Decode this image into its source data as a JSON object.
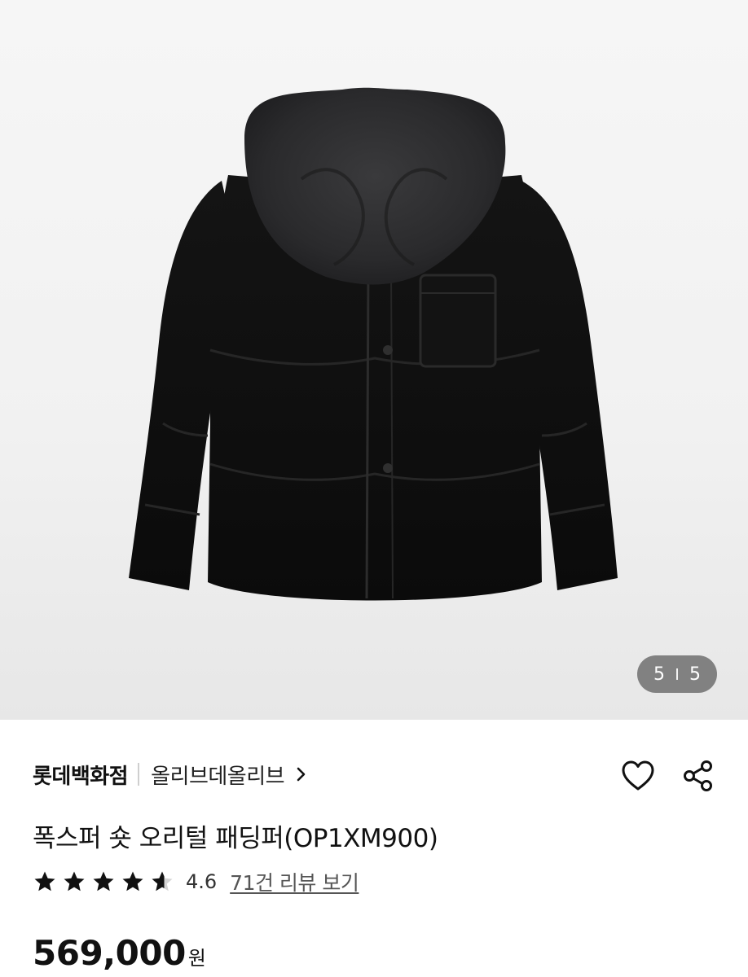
{
  "gallery": {
    "current": "5",
    "total": "5"
  },
  "brand": {
    "name": "롯데백화점",
    "shop": "올리브데올리브"
  },
  "product": {
    "title": "폭스퍼 숏 오리털 패딩퍼(OP1XM900)",
    "rating": "4.6",
    "rating_stars": 4.6,
    "review_link": "71건 리뷰 보기",
    "price": "569,000",
    "currency": "원"
  },
  "icons": {
    "like": "heart-icon",
    "share": "share-icon",
    "chevron": "chevron-right-icon",
    "star": "star-icon"
  },
  "colors": {
    "text": "#111111",
    "muted": "#555555",
    "counter_bg": "#6e6e6e"
  }
}
